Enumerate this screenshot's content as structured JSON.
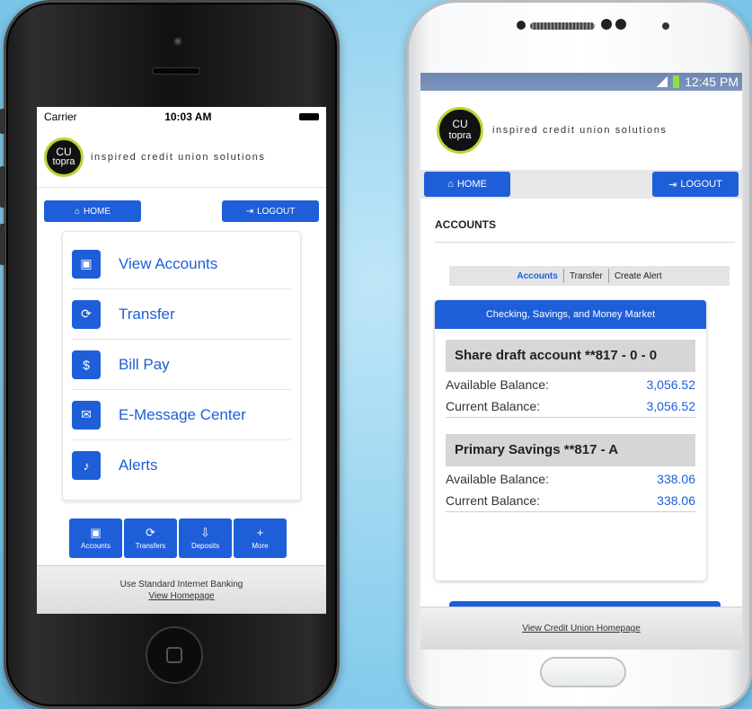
{
  "brand": {
    "logo_top": "CU",
    "logo_bottom": "topra",
    "tagline": "inspired credit union solutions"
  },
  "ios": {
    "status": {
      "carrier": "Carrier",
      "time": "10:03 AM"
    },
    "nav": {
      "home_label": "HOME",
      "logout_label": "LOGOUT"
    },
    "menu": [
      {
        "label": "View Accounts",
        "icon": "briefcase-icon",
        "glyph": "▣"
      },
      {
        "label": "Transfer",
        "icon": "refresh-icon",
        "glyph": "⟳"
      },
      {
        "label": "Bill Pay",
        "icon": "dollar-coin-icon",
        "glyph": "$"
      },
      {
        "label": "E-Message Center",
        "icon": "envelope-icon",
        "glyph": "✉"
      },
      {
        "label": "Alerts",
        "icon": "bell-icon",
        "glyph": "♪"
      }
    ],
    "tabs": [
      {
        "label": "Accounts",
        "icon": "briefcase-icon",
        "glyph": "▣"
      },
      {
        "label": "Transfers",
        "icon": "refresh-icon",
        "glyph": "⟳"
      },
      {
        "label": "Deposits",
        "icon": "deposit-icon",
        "glyph": "⇩"
      },
      {
        "label": "More",
        "icon": "plus-icon",
        "glyph": "+"
      }
    ],
    "footer": {
      "text": "Use Standard Internet Banking",
      "link": "View Homepage"
    }
  },
  "android": {
    "status": {
      "time": "12:45 PM"
    },
    "nav": {
      "home_label": "HOME",
      "logout_label": "LOGOUT"
    },
    "page_title": "ACCOUNTS",
    "segments": [
      "Accounts",
      "Transfer",
      "Create Alert"
    ],
    "panel_title": "Checking, Savings, and Money Market",
    "accounts": [
      {
        "name": "Share draft account **817 - 0 - 0",
        "available_label": "Available Balance:",
        "available": "3,056.52",
        "current_label": "Current Balance:",
        "current": "3,056.52"
      },
      {
        "name": "Primary Savings **817 - A",
        "available_label": "Available Balance:",
        "available": "338.06",
        "current_label": "Current Balance:",
        "current": "338.06"
      }
    ],
    "footer_link": "View Credit Union Homepage"
  },
  "colors": {
    "accent": "#1e5fd9",
    "logo_ring": "#b7d432"
  }
}
